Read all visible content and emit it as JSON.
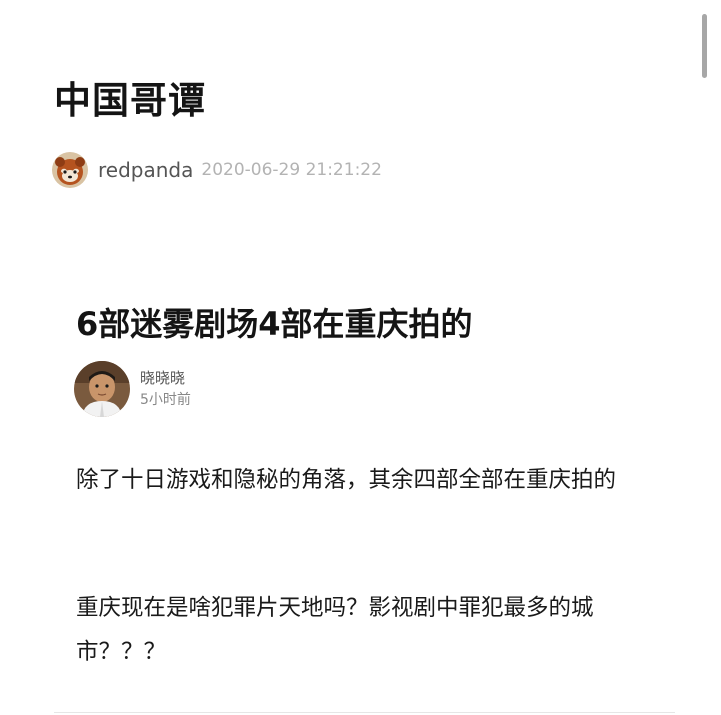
{
  "site": {
    "title": "中国哥谭"
  },
  "post_meta": {
    "username": "redpanda",
    "timestamp": "2020-06-29 21:21:22",
    "avatar_icon": "red-panda-avatar"
  },
  "article": {
    "title": "6部迷雾剧场4部在重庆拍的",
    "author": {
      "name": "晓晓晓",
      "time": "5小时前",
      "avatar_icon": "child-photo-avatar"
    },
    "paragraphs": [
      "除了十日游戏和隐秘的角落，其余四部全部在重庆拍的",
      "重庆现在是啥犯罪片天地吗？影视剧中罪犯最多的城市？？？"
    ]
  },
  "colors": {
    "background": "#ffffff",
    "title_text": "#141414",
    "meta_text": "#b3b3b3",
    "scrollbar": "#a7a7a7"
  }
}
